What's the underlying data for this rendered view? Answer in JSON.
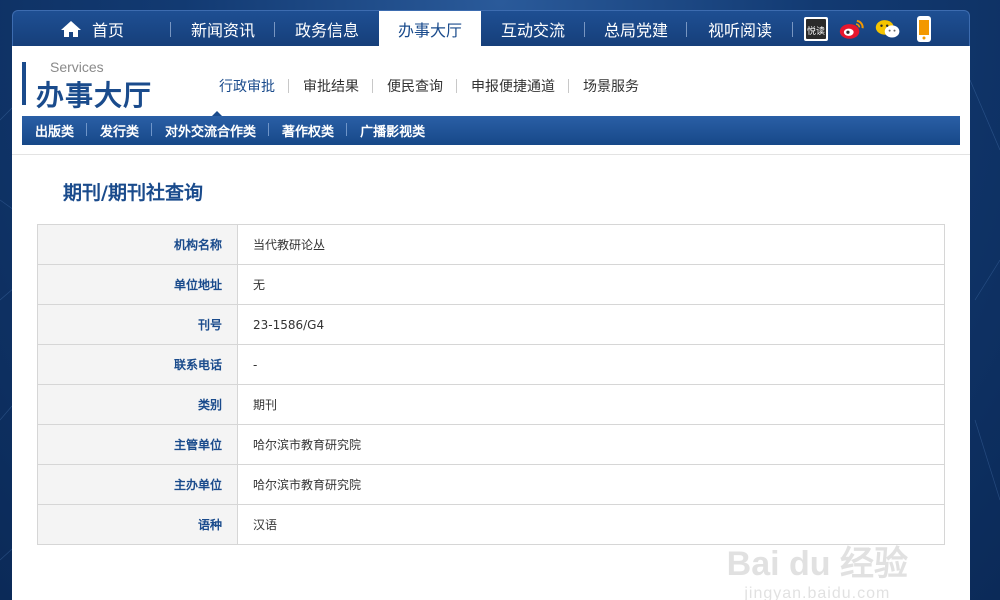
{
  "topnav": {
    "items": [
      {
        "label": "首页",
        "icon": "home-icon"
      },
      {
        "label": "新闻资讯"
      },
      {
        "label": "政务信息"
      },
      {
        "label": "办事大厅",
        "active": true
      },
      {
        "label": "互动交流"
      },
      {
        "label": "总局党建"
      },
      {
        "label": "视听阅读"
      }
    ],
    "social_icons": [
      "yuedu-icon",
      "weibo-icon",
      "wechat-icon",
      "mobile-icon"
    ],
    "yuedu_label": "悦读"
  },
  "services": {
    "en": "Services",
    "cn": "办事大厅"
  },
  "subnav": {
    "items": [
      "行政审批",
      "审批结果",
      "便民查询",
      "申报便捷通道",
      "场景服务"
    ]
  },
  "categories": {
    "items": [
      "出版类",
      "发行类",
      "对外交流合作类",
      "著作权类",
      "广播影视类"
    ]
  },
  "page": {
    "title": "期刊/期刊社查询"
  },
  "table": {
    "rows": [
      {
        "label": "机构名称",
        "value": "当代教研论丛"
      },
      {
        "label": "单位地址",
        "value": "无"
      },
      {
        "label": "刊号",
        "value": "23-1586/G4"
      },
      {
        "label": "联系电话",
        "value": "-"
      },
      {
        "label": "类别",
        "value": "期刊"
      },
      {
        "label": "主管单位",
        "value": "哈尔滨市教育研究院"
      },
      {
        "label": "主办单位",
        "value": "哈尔滨市教育研究院"
      },
      {
        "label": "语种",
        "value": "汉语"
      }
    ]
  },
  "watermark": {
    "main": "Bai du 经验",
    "sub": "jingyan.baidu.com"
  },
  "colors": {
    "brand": "#1a4b8c",
    "background": "#123a72"
  }
}
